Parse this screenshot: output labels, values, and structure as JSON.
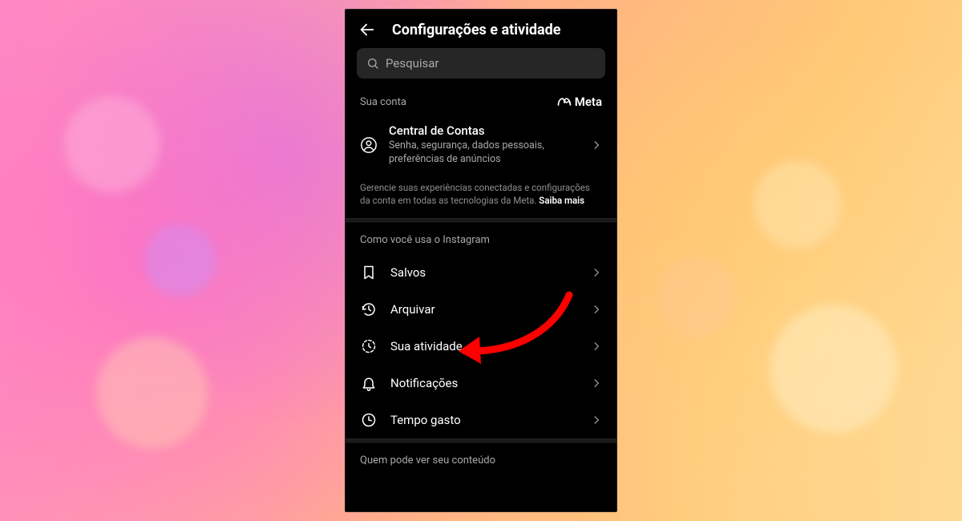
{
  "header": {
    "title": "Configurações e atividade"
  },
  "search": {
    "placeholder": "Pesquisar"
  },
  "account": {
    "section_label": "Sua conta",
    "brand": "Meta",
    "title": "Central de Contas",
    "subtitle": "Senha, segurança, dados pessoais, preferências de anúncios",
    "description_prefix": "Gerencie suas experiências conectadas e configurações da conta em todas as tecnologias da Meta. ",
    "description_link": "Saiba mais"
  },
  "usage": {
    "section_title": "Como você usa o Instagram",
    "items": [
      {
        "label": "Salvos",
        "icon": "bookmark"
      },
      {
        "label": "Arquivar",
        "icon": "archive"
      },
      {
        "label": "Sua atividade",
        "icon": "activity"
      },
      {
        "label": "Notificações",
        "icon": "bell"
      },
      {
        "label": "Tempo gasto",
        "icon": "clock"
      }
    ]
  },
  "visibility": {
    "section_title": "Quem pode ver seu conteúdo"
  }
}
